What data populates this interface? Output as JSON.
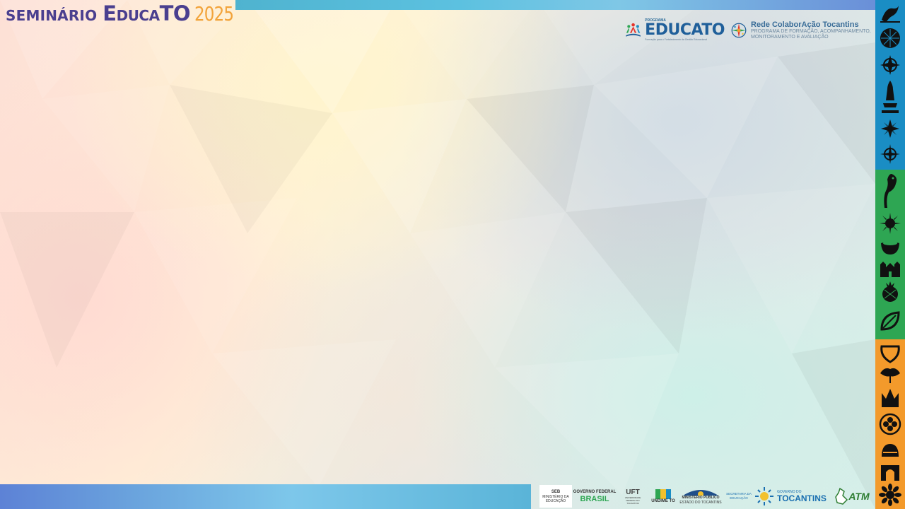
{
  "header": {
    "title_part1": "Seminário",
    "title_part2": "EducaTO",
    "title_year": "2025"
  },
  "logos": {
    "educato": {
      "small": "PROGRAMA",
      "name": "EDUCATO",
      "tagline": "Formação para o Fortalecimento da Gestão Educacional"
    },
    "rede": {
      "title": "Rede ColaborAção Tocantins",
      "subtitle": "PROGRAMA DE FORMAÇÃO, ACOMPANHAMENTO, MONITORAMENTO E AVALIAÇÃO"
    }
  },
  "partners": [
    {
      "a": "SEB",
      "b": "MINISTÉRIO DA EDUCAÇÃO"
    },
    {
      "a": "GOVERNO FEDERAL",
      "b": "BRASIL"
    },
    {
      "a": "UFT",
      "b": "UNIVERSIDADE FEDERAL DO TOCANTINS"
    },
    {
      "a": "UNDIME TO",
      "b": ""
    },
    {
      "a": "MINISTÉRIO PÚBLICO",
      "b": "ESTADO DO TOCANTINS"
    },
    {
      "a": "SECRETARIA DA EDUCAÇÃO",
      "b": ""
    },
    {
      "a": "TOCANTINS",
      "b": "GOVERNO DO"
    },
    {
      "a": "ATM",
      "b": ""
    }
  ],
  "strip_icons": [
    "bird-icon",
    "shell-icon",
    "compass-rose-icon",
    "statue-icon",
    "compass-star-icon",
    "compass-small-icon",
    "bird-head-icon",
    "sun-icon",
    "bowl-icon",
    "church-icon",
    "pineapple-icon",
    "leaf-icon",
    "pot-icon",
    "flower-icon",
    "crown-icon",
    "circle-flower-icon",
    "hat-icon",
    "gate-icon",
    "sunflower-icon"
  ],
  "colors": {
    "title_purple": "#4a3f8f",
    "title_orange": "#f2a33a",
    "strip_blue": "#1a8dc4",
    "strip_green": "#2ea653",
    "strip_orange": "#f39a2b"
  }
}
